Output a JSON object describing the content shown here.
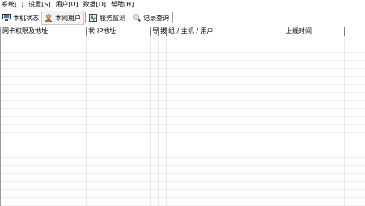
{
  "menu": [
    "系统[T]",
    "设置[S]",
    "用户[U]",
    "数据[D]",
    "帮助[H]"
  ],
  "toolbar": {
    "buttons": [
      {
        "label": "本机状态",
        "icon": "computer-status-icon",
        "active": false
      },
      {
        "label": "本网用户",
        "icon": "network-users-icon",
        "active": true
      },
      {
        "label": "服务监测",
        "icon": "service-monitor-icon",
        "active": false
      },
      {
        "label": "记录查询",
        "icon": "record-search-icon",
        "active": false
      }
    ]
  },
  "table": {
    "columns": [
      "网卡权限及地址",
      "状",
      "IP地址",
      "导",
      "拔",
      "组 / 主机 / 用户",
      "上线时间",
      ""
    ],
    "rows": []
  },
  "colors": {
    "grid_line": "#808080",
    "row_line": "#eeeeee"
  }
}
